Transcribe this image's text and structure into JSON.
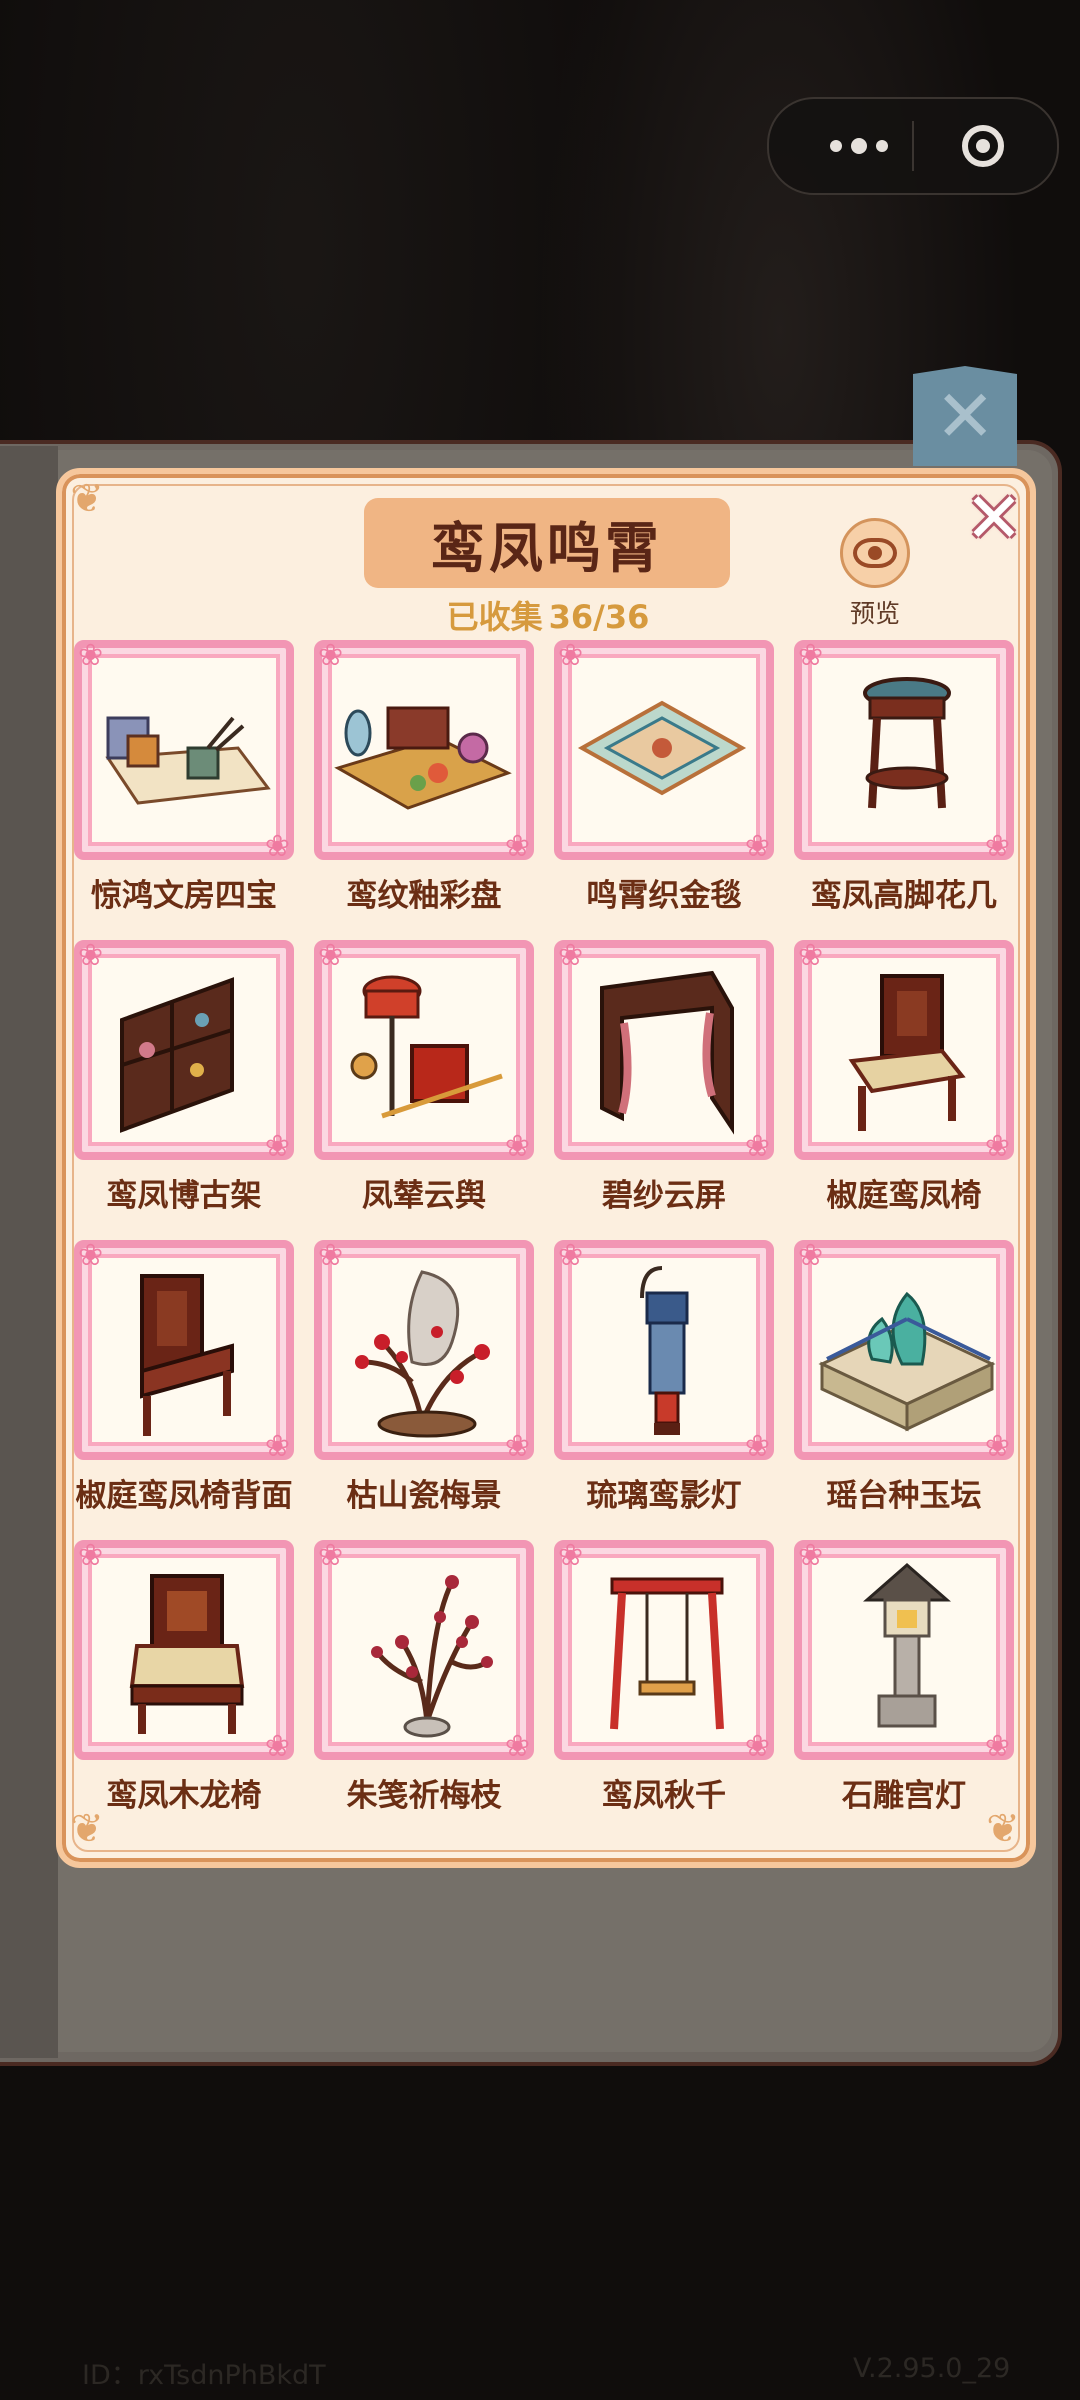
{
  "header": {
    "title": "鸾凤鸣霄",
    "progress_label": "已收集",
    "progress_value": "36/36"
  },
  "preview": {
    "label": "预览",
    "icon": "eye-icon"
  },
  "close": {
    "icon": "close-icon"
  },
  "items": [
    {
      "name": "惊鸿文房四宝"
    },
    {
      "name": "鸾纹釉彩盘"
    },
    {
      "name": "鸣霄织金毯"
    },
    {
      "name": "鸾凤高脚花几"
    },
    {
      "name": "鸾凤博古架"
    },
    {
      "name": "凤辇云舆"
    },
    {
      "name": "碧纱云屏"
    },
    {
      "name": "椒庭鸾凤椅"
    },
    {
      "name": "椒庭鸾凤椅背面"
    },
    {
      "name": "枯山瓷梅景"
    },
    {
      "name": "琉璃鸾影灯"
    },
    {
      "name": "瑶台种玉坛"
    },
    {
      "name": "鸾凤木龙椅"
    },
    {
      "name": "朱笺祈梅枝"
    },
    {
      "name": "鸾凤秋千"
    },
    {
      "name": "石雕宫灯"
    }
  ],
  "footer": {
    "id_text": "ID：rxTsdnPhBkdT",
    "version": "V.2.95.0_29"
  },
  "colors": {
    "panel_bg": "#fcefdf",
    "frame_pink": "#f296b4",
    "title_plate": "#f0b584",
    "label_brown": "#6b2e14"
  }
}
